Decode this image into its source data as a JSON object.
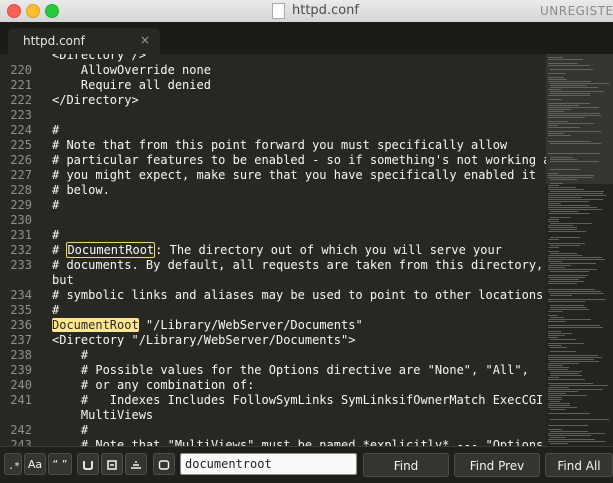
{
  "window": {
    "title": "httpd.conf",
    "status": "UNREGISTERED"
  },
  "tab": {
    "label": "httpd.conf",
    "close": "×"
  },
  "lines": [
    {
      "num": "",
      "segments": [
        {
          "text": "<Directory />"
        }
      ]
    },
    {
      "num": "220",
      "segments": [
        {
          "text": "    AllowOverride none"
        }
      ]
    },
    {
      "num": "221",
      "segments": [
        {
          "text": "    Require all denied"
        }
      ]
    },
    {
      "num": "222",
      "segments": [
        {
          "text": "</Directory>"
        }
      ]
    },
    {
      "num": "223",
      "segments": []
    },
    {
      "num": "224",
      "segments": [
        {
          "text": "#"
        }
      ]
    },
    {
      "num": "225",
      "segments": [
        {
          "text": "# Note that from this point forward you must specifically allow"
        }
      ]
    },
    {
      "num": "226",
      "segments": [
        {
          "text": "# particular features to be enabled - so if something's not working as"
        }
      ]
    },
    {
      "num": "227",
      "segments": [
        {
          "text": "# you might expect, make sure that you have specifically enabled it"
        }
      ]
    },
    {
      "num": "228",
      "segments": [
        {
          "text": "# below."
        }
      ]
    },
    {
      "num": "229",
      "segments": [
        {
          "text": "#"
        }
      ]
    },
    {
      "num": "230",
      "segments": []
    },
    {
      "num": "231",
      "segments": [
        {
          "text": "#"
        }
      ]
    },
    {
      "num": "232",
      "segments": [
        {
          "text": "# "
        },
        {
          "text": "DocumentRoot",
          "hl": "box"
        },
        {
          "text": ": The directory out of which you will serve your"
        }
      ]
    },
    {
      "num": "233",
      "segments": [
        {
          "text": "# documents. By default, all requests are taken from this directory,"
        }
      ]
    },
    {
      "num": "",
      "segments": [
        {
          "text": "but"
        }
      ]
    },
    {
      "num": "234",
      "segments": [
        {
          "text": "# symbolic links and aliases may be used to point to other locations."
        }
      ]
    },
    {
      "num": "235",
      "segments": [
        {
          "text": "#"
        }
      ]
    },
    {
      "num": "236",
      "segments": [
        {
          "text": "DocumentRoot",
          "hl": "fill"
        },
        {
          "text": " \"/Library/WebServer/Documents\""
        }
      ]
    },
    {
      "num": "237",
      "segments": [
        {
          "text": "<Directory \"/Library/WebServer/Documents\">"
        }
      ]
    },
    {
      "num": "238",
      "segments": [
        {
          "text": "    #"
        }
      ]
    },
    {
      "num": "239",
      "segments": [
        {
          "text": "    # Possible values for the Options directive are \"None\", \"All\","
        }
      ]
    },
    {
      "num": "240",
      "segments": [
        {
          "text": "    # or any combination of:"
        }
      ]
    },
    {
      "num": "241",
      "segments": [
        {
          "text": "    #   Indexes Includes FollowSymLinks SymLinksifOwnerMatch ExecCGI"
        }
      ]
    },
    {
      "num": "",
      "segments": [
        {
          "text": "    MultiViews"
        }
      ]
    },
    {
      "num": "242",
      "segments": [
        {
          "text": "    #"
        }
      ]
    },
    {
      "num": "243",
      "segments": [
        {
          "text": "    # Note that \"MultiViews\" must be named *explicitly* --- \"Options"
        }
      ]
    }
  ],
  "findbar": {
    "regex_icon": "regex-icon",
    "case_label": "Aa",
    "word_label": "“ ”",
    "wrap_icon": "wrap-icon",
    "in_selection_icon": "in-selection-icon",
    "highlight_icon": "highlight-matches-icon",
    "input_value": "documentroot",
    "find_label": "Find",
    "find_prev_label": "Find Prev",
    "find_all_label": "Find All"
  }
}
